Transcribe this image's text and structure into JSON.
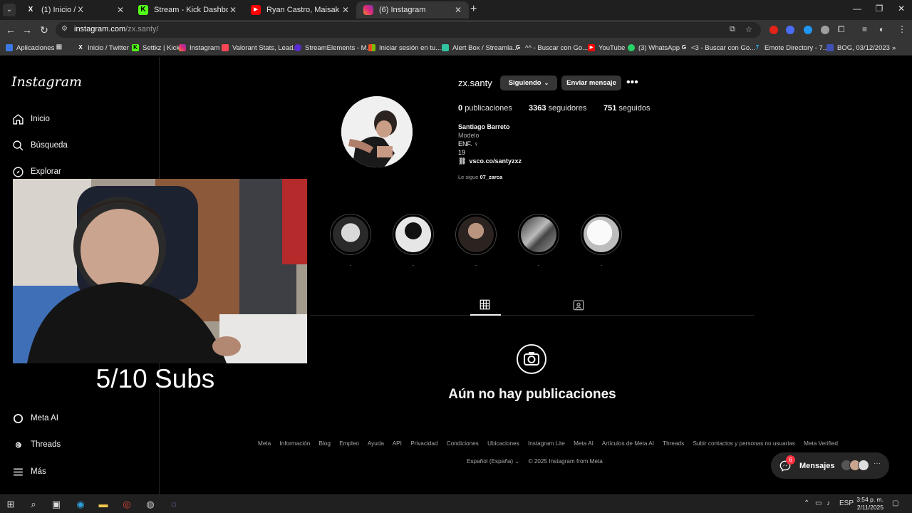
{
  "browser": {
    "tabs": [
      {
        "title": "(1) Inicio / X",
        "favicon": "x-logo"
      },
      {
        "title": "Stream - Kick Dashboard",
        "favicon": "kick-logo"
      },
      {
        "title": "Ryan Castro, Maisak - FDSR (Vi",
        "favicon": "youtube-logo"
      },
      {
        "title": "(6) Instagram",
        "favicon": "instagram-logo"
      }
    ],
    "new_tab_label": "+",
    "url_host": "instagram.com",
    "url_path": "/zx.santy/",
    "bookmarks": [
      {
        "label": "Aplicaciones",
        "icon": "apps-grid-icon"
      },
      {
        "label": "Inicio / Twitter",
        "icon": "x-logo"
      },
      {
        "label": "Settkz | Kick",
        "icon": "kick-logo"
      },
      {
        "label": "Instagram",
        "icon": "instagram-logo"
      },
      {
        "label": "Valorant Stats, Lead...",
        "icon": "valorant-icon"
      },
      {
        "label": "StreamElements - M...",
        "icon": "streamelements-icon"
      },
      {
        "label": "Iniciar sesión en tu...",
        "icon": "microsoft-icon"
      },
      {
        "label": "Alert Box / Streamla...",
        "icon": "streamlabs-icon"
      },
      {
        "label": "^^ - Buscar con Go...",
        "icon": "google-icon"
      },
      {
        "label": "YouTube",
        "icon": "youtube-logo"
      },
      {
        "label": "(3) WhatsApp",
        "icon": "whatsapp-icon"
      },
      {
        "label": "<3 - Buscar con Go...",
        "icon": "google-icon"
      },
      {
        "label": "Emote Directory - 7...",
        "icon": "7tv-icon"
      },
      {
        "label": "BOG, 03/12/2023",
        "icon": "bookmark-icon"
      }
    ]
  },
  "sidebar": {
    "logo": "Instagram",
    "items_top": [
      {
        "label": "Inicio",
        "icon": "home-icon"
      },
      {
        "label": "Búsqueda",
        "icon": "search-icon"
      },
      {
        "label": "Explorar",
        "icon": "compass-icon"
      }
    ],
    "items_bottom": [
      {
        "label": "Meta AI",
        "icon": "meta-ai-icon"
      },
      {
        "label": "Threads",
        "icon": "threads-icon"
      },
      {
        "label": "Más",
        "icon": "menu-icon"
      }
    ]
  },
  "profile": {
    "username": "zx.santy",
    "follow_button": "Siguiendo",
    "message_button": "Enviar mensaje",
    "more": "•••",
    "posts_count": "0",
    "posts_label": "publicaciones",
    "followers_count": "3363",
    "followers_label": "seguidores",
    "following_count": "751",
    "following_label": "seguidos",
    "name": "Santiago Barreto",
    "category": "Modelo",
    "bio_line1": "ENF. ♀",
    "bio_line2": "19",
    "link": "vsco.co/santyzxz",
    "followed_by_prefix": "Le sigue",
    "followed_by_user": "07_zarca",
    "highlights": [
      ".",
      ".",
      ".",
      ".",
      "."
    ],
    "empty_title": "Aún no hay publicaciones"
  },
  "footer": {
    "links": [
      "Meta",
      "Información",
      "Blog",
      "Empleo",
      "Ayuda",
      "API",
      "Privacidad",
      "Condiciones",
      "Ubicaciones",
      "Instagram Lite",
      "Meta AI",
      "Artículos de Meta AI",
      "Threads",
      "Subir contactos y personas no usuarias",
      "Meta Verified"
    ],
    "language": "Español (España)",
    "copyright": "© 2025 Instagram from Meta"
  },
  "messages": {
    "label": "Mensajes",
    "badge": "6"
  },
  "overlay": {
    "sub_goal": "5/10 Subs"
  },
  "taskbar": {
    "lang": "ESP",
    "time": "3:54 p. m.",
    "date": "2/11/2025"
  },
  "colors": {
    "background": "#000000",
    "panel": "#262626",
    "button": "#363636",
    "badge": "#ff3040",
    "muted_text": "#a8a8a8"
  }
}
